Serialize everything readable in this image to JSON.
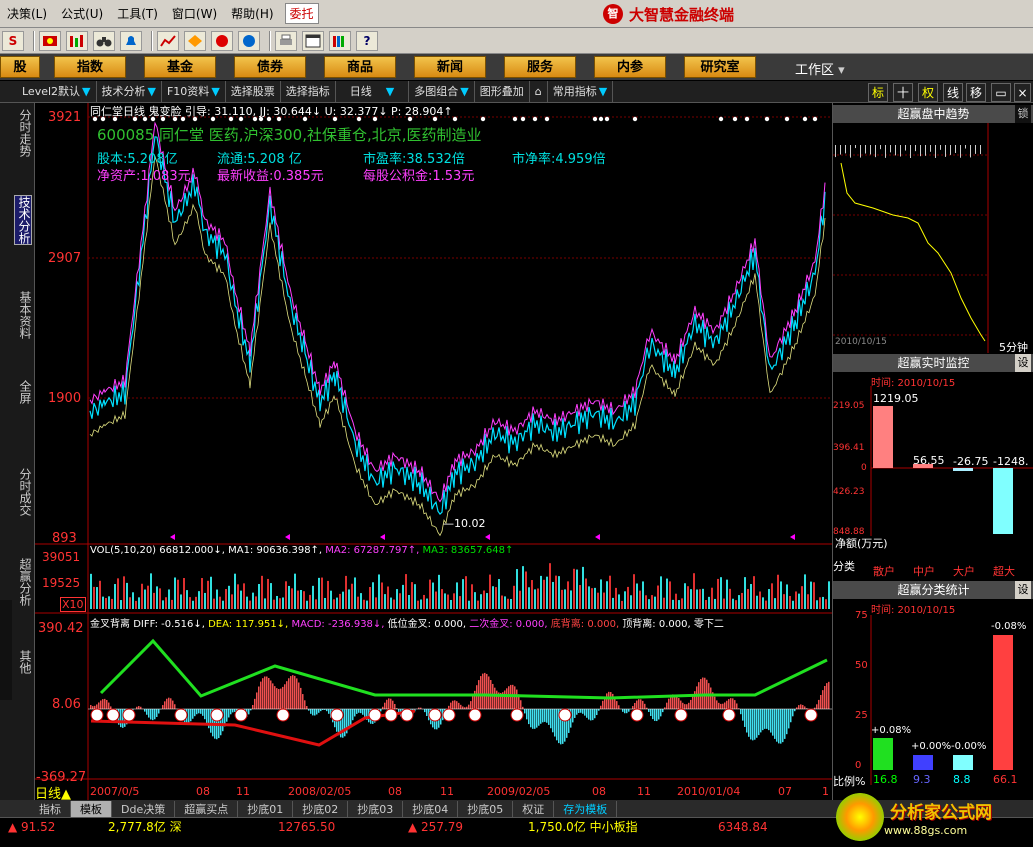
{
  "menubar": {
    "items": [
      "决策(L)",
      "公式(U)",
      "工具(T)",
      "窗口(W)",
      "帮助(H)"
    ],
    "entrust": "委托",
    "brand": "大智慧金融终端",
    "brand_logo": "智"
  },
  "toolbar": {
    "icons": [
      "s-icon",
      "flag-icon",
      "bars-icon",
      "binoculars-icon",
      "bell-icon",
      "chart-icon",
      "diamond-icon",
      "ball-red-icon",
      "ball-blue-icon",
      "printer-icon",
      "window-icon",
      "books-icon",
      "help-icon"
    ]
  },
  "funcbar": {
    "items": [
      "股",
      "指数",
      "基金",
      "债券",
      "商品",
      "新闻",
      "服务",
      "内参",
      "研究室"
    ],
    "workarea": "工作区"
  },
  "subbar": {
    "items": [
      "Level2默认",
      "技术分析",
      "F10资料",
      "选择股票",
      "选择指标",
      "日线",
      "多图组合",
      "图形叠加",
      "常用指标"
    ],
    "right_tabs": [
      "标",
      "十",
      "权",
      "线",
      "移"
    ]
  },
  "left_tabs": [
    "分时走势",
    "技术分析",
    "基本资料",
    "全屏",
    "分时成交",
    "超赢分析",
    "其他"
  ],
  "main_chart": {
    "header": "同仁堂日线 鬼变脸 引导: 31.110, JJ: 30.644↓ U: 32.377↓ P: 28.904↑",
    "stock_line": "600085 同仁堂 医药,沪深300,社保重仓,北京,医药制造业",
    "info": [
      {
        "label": "股本:5.208亿",
        "color": "#00e0e0"
      },
      {
        "label": "流通:5.208 亿",
        "color": "#00e0e0"
      },
      {
        "label": "市盈率:38.532倍",
        "color": "#00e0e0"
      },
      {
        "label": "市净率:4.959倍",
        "color": "#00e0e0"
      },
      {
        "label": "净资产:1.083元",
        "color": "#ff40ff"
      },
      {
        "label": "最新收益:0.385元",
        "color": "#ff40ff"
      },
      {
        "label": "每股公积金:1.53元",
        "color": "#ff40ff"
      }
    ],
    "y_labels": [
      "3921",
      "2907",
      "1900",
      "893"
    ],
    "low_label": "—10.02"
  },
  "vol_panel": {
    "header_parts": [
      {
        "t": "VOL(5,10,20) 66812.000↓,",
        "c": "#ffffff"
      },
      {
        "t": "MA1: 90636.398↑,",
        "c": "#ffffff"
      },
      {
        "t": "MA2: 67287.797↑,",
        "c": "#ff40ff"
      },
      {
        "t": "MA3: 83657.648↑",
        "c": "#00e000"
      }
    ],
    "y_labels": [
      "39051",
      "19525",
      "X10"
    ]
  },
  "macd_panel": {
    "header_parts": [
      {
        "t": "金叉背离",
        "c": "#ffffff"
      },
      {
        "t": "DIFF: -0.516↓,",
        "c": "#ffffff"
      },
      {
        "t": "DEA: 117.951↓,",
        "c": "#ffff00"
      },
      {
        "t": "MACD: -236.938↓,",
        "c": "#ff40ff"
      },
      {
        "t": "低位金叉: 0.000,",
        "c": "#ffffff"
      },
      {
        "t": "二次金叉: 0.000,",
        "c": "#ff40ff"
      },
      {
        "t": "底背离: 0.000,",
        "c": "#ff4040"
      },
      {
        "t": "顶背离: 0.000,",
        "c": "#ffffff"
      },
      {
        "t": "零下二",
        "c": "#ffffff"
      }
    ],
    "y_labels": [
      "390.42",
      "8.06",
      "-369.27"
    ]
  },
  "x_axis": [
    "2007/0/5",
    "08",
    "11",
    "2008/02/05",
    "08",
    "11",
    "2009/02/05",
    "08",
    "11",
    "2010/01/04",
    "07",
    "1"
  ],
  "right_panel": {
    "trend_title": "超赢盘中趋势",
    "trend_tab": "锁",
    "trend_date": "2010/10/15",
    "trend_period": "5分钟",
    "monitor_title": "超赢实时监控",
    "monitor_time": "时间: 2010/10/15",
    "monitor_values": [
      "1219.05",
      "56.55",
      "-26.75",
      "-1248."
    ],
    "monitor_axis": [
      "219.05",
      "396.41",
      "0",
      "426.23",
      "848.88"
    ],
    "monitor_foot": "净额(万元)",
    "classes_label": "分类",
    "classes": [
      "散户",
      "中户",
      "大户",
      "超大"
    ],
    "stats_title": "超赢分类统计",
    "stats_time": "时间: 2010/10/15",
    "stats_pct": [
      "+0.08%",
      "+0.00%",
      "-0.00%",
      "-0.08%"
    ],
    "stats_axis": [
      "75",
      "50",
      "25",
      "0"
    ],
    "ratio_label": "比例%",
    "ratio_values": [
      "16.8",
      "9.3",
      "8.8",
      "66.1"
    ],
    "set_label": "设"
  },
  "bottom1": {
    "period": "日线",
    "tabs": [
      "指标",
      "模板",
      "Dde决策",
      "超赢买点",
      "抄底01",
      "抄底02",
      "抄底03",
      "抄底04",
      "抄底05",
      "权证",
      "存为模板"
    ]
  },
  "bottom2": {
    "items": [
      "▲ 91.52",
      "2,777.8亿 深",
      "12765.50",
      "▲ 257.79",
      "1,750.0亿 中小板指",
      "6348.84"
    ]
  },
  "watermark": {
    "text": "分析家公式网",
    "url": "www.88gs.com"
  },
  "chart_data": {
    "type": "line",
    "title": "同仁堂日线",
    "x": [
      "2007/0/5",
      "08",
      "11",
      "2008/02/05",
      "08",
      "11",
      "2009/02/05",
      "08",
      "11",
      "2010/01/04",
      "07",
      "1"
    ],
    "ylabel": "",
    "ylim": [
      893,
      3921
    ],
    "series": []
  }
}
